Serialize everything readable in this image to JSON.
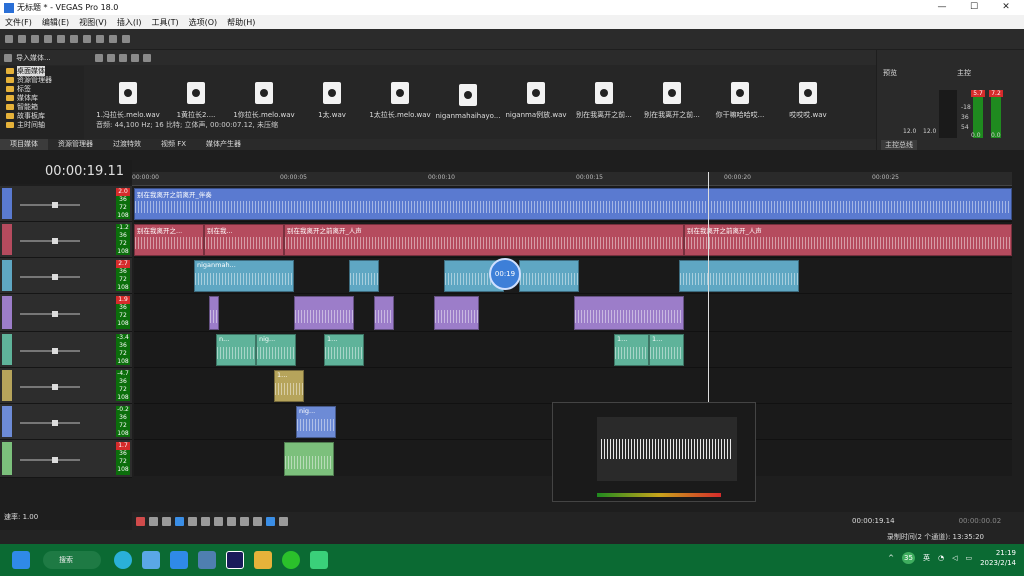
{
  "window": {
    "title": "无标题 * - VEGAS Pro 18.0"
  },
  "menu": [
    "文件(F)",
    "编辑(E)",
    "视图(V)",
    "插入(I)",
    "工具(T)",
    "选项(O)",
    "帮助(H)"
  ],
  "explorer": {
    "dropdown": "导入媒体...",
    "tree": [
      "桌面媒体",
      "资源管理器",
      "标签",
      "媒体库",
      "智能箱",
      "故事板库",
      "主时间轴"
    ],
    "media": [
      "1.冯拉长.melo.wav",
      "1黄拉长2....",
      "1你拉长.melo.wav",
      "1太.wav",
      "1太拉长.melo.wav",
      "niganmahaihayo...",
      "niganma例放.wav",
      "别在我离开之前...",
      "别在我离开之前...",
      "你干嘛哈哈哎...",
      "哎哎哎.wav"
    ],
    "file_info": "音频: 44,100 Hz; 16 比特; 立体声, 00:00:07.12, 未压缩",
    "tabs": [
      "项目媒体",
      "资源管理器",
      "过渡特效",
      "视频 FX",
      "媒体产生器"
    ]
  },
  "preview": {
    "label": "预览",
    "master_label": "主控",
    "master_tab": "主控总线",
    "meter_vals": [
      "5.7",
      "7.2"
    ],
    "scale": [
      "-18",
      "36",
      "54"
    ],
    "foot": [
      "12.0",
      "12.0",
      "0.0",
      "0.0"
    ]
  },
  "timeline": {
    "timecode": "00:00:19.11",
    "ruler": [
      "00:00:00",
      "00:00:05",
      "00:00:10",
      "00:00:15",
      "00:00:20",
      "00:00:25"
    ],
    "cursor_bubble": "00:19",
    "tracks": [
      {
        "vol": "2.0",
        "hot": true,
        "color": "#5a7ad0",
        "clips": [
          {
            "label": "别在我离开之前离开_伴奏"
          }
        ]
      },
      {
        "vol": "-1.2",
        "hot": false,
        "color": "#b54b5e",
        "clips": [
          {
            "label": "别在我离开之..."
          },
          {
            "label": "别在我..."
          },
          {
            "label": "别在我离开之前离开_人声"
          },
          {
            "label": "别在我离开之前离开_人声"
          }
        ]
      },
      {
        "vol": "2.7",
        "hot": true,
        "color": "#5fa7c3",
        "clips": [
          {
            "label": "niganmah..."
          }
        ]
      },
      {
        "vol": "1.9",
        "hot": true,
        "color": "#9c7dc9",
        "clips": []
      },
      {
        "vol": "-3.4",
        "hot": false,
        "color": "#5fb39a",
        "clips": [
          {
            "label": "n..."
          },
          {
            "label": "nig..."
          },
          {
            "label": "1..."
          },
          {
            "label": "1..."
          },
          {
            "label": "1..."
          }
        ]
      },
      {
        "vol": "-4.7",
        "hot": false,
        "color": "#b6a45b",
        "clips": [
          {
            "label": "1..."
          }
        ]
      },
      {
        "vol": "-0.2",
        "hot": false,
        "color": "#6d8bd6",
        "clips": [
          {
            "label": "nig..."
          }
        ]
      },
      {
        "vol": "1.7",
        "hot": true,
        "color": "#7cc07c",
        "clips": []
      }
    ],
    "meter_scale": [
      "36",
      "72",
      "108"
    ]
  },
  "transport": {
    "rate": "速率: 1.00",
    "timecode": "00:00:19.14",
    "end": "00:00:00.02"
  },
  "status": "录制时间(2 个通道): 13:35:20",
  "taskbar": {
    "search": "搜索",
    "lang": "英",
    "weather": "35",
    "time": "21:19",
    "date": "2023/2/14"
  }
}
